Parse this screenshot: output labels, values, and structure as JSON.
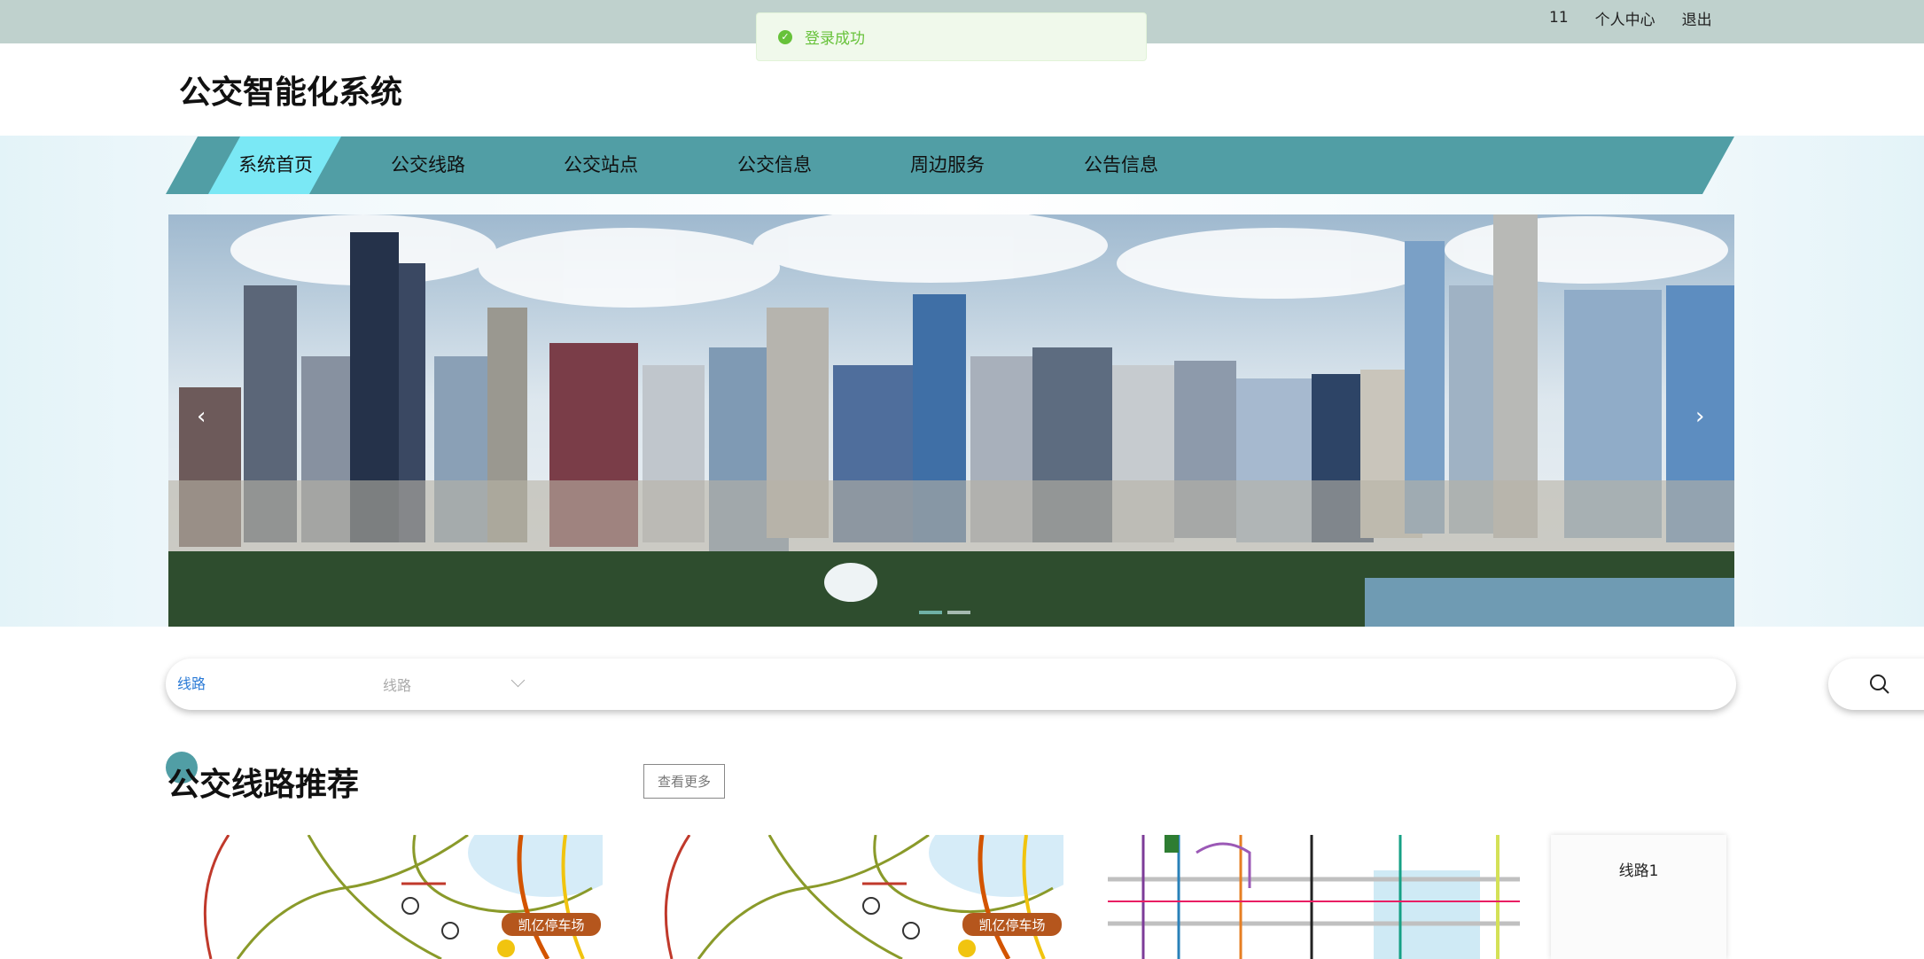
{
  "topbar": {
    "user": "11",
    "profile_label": "个人中心",
    "logout_label": "退出"
  },
  "toast": {
    "message": "登录成功"
  },
  "header": {
    "title": "公交智能化系统"
  },
  "nav": {
    "items": [
      {
        "label": "系统首页",
        "active": true
      },
      {
        "label": "公交线路"
      },
      {
        "label": "公交站点"
      },
      {
        "label": "公交信息"
      },
      {
        "label": "周边服务"
      },
      {
        "label": "公告信息"
      }
    ]
  },
  "banner": {
    "prev": "‹",
    "next": "›"
  },
  "search": {
    "select_value": "线路",
    "placeholder": "线路"
  },
  "section": {
    "title": "公交线路推荐",
    "more_label": "查看更多",
    "cards": [
      {
        "map_label": "凯亿停车场"
      },
      {
        "map_label": "凯亿停车场"
      },
      {
        "map_label": ""
      },
      {
        "text": "线路1"
      }
    ]
  },
  "colors": {
    "nav": "#519ea5",
    "nav_active": "#7ae8f5",
    "topbar": "#bfd1cd",
    "toast_text": "#67c23a"
  }
}
